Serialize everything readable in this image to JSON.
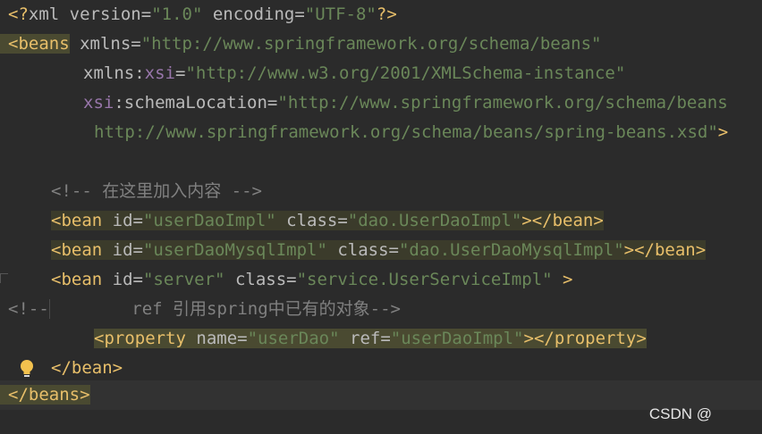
{
  "lines": {
    "l1": {
      "p1": "<?",
      "p2": "xml ",
      "p3": "version",
      "p4": "=",
      "p5": "\"1.0\"",
      "p6": " encoding",
      "p7": "=",
      "p8": "\"UTF-8\"",
      "p9": "?>"
    },
    "l2": {
      "p1": "<beans",
      "p2": " xmlns",
      "p3": "=",
      "p4": "\"http://www.springframework.org/schema/beans\""
    },
    "l3": {
      "p1": "xmlns",
      "p2": ":",
      "p3": "xsi",
      "p4": "=",
      "p5": "\"http://www.w3.org/2001/XMLSchema-instance\""
    },
    "l4": {
      "p1": "xsi",
      "p2": ":schemaLocation",
      "p3": "=",
      "p4": "\"http://www.springframework.org/schema/beans"
    },
    "l5": {
      "p1": "http://www.springframework.org/schema/beans/spring-beans.xsd\"",
      "p2": ">"
    },
    "l7": {
      "p1": "<!-- 在这里加入内容 -->"
    },
    "l8": {
      "p1": "<bean",
      "p2": " id",
      "p3": "=",
      "p4": "\"userDaoImpl\"",
      "p5": " class",
      "p6": "=",
      "p7": "\"dao.UserDaoImpl\"",
      "p8": "></bean>"
    },
    "l9": {
      "p1": "<bean",
      "p2": " id",
      "p3": "=",
      "p4": "\"userDaoMysqlImpl\"",
      "p5": " class",
      "p6": "=",
      "p7": "\"dao.UserDaoMysqlImpl\"",
      "p8": "></bean>"
    },
    "l10": {
      "p1": "<bean",
      "p2": " id",
      "p3": "=",
      "p4": "\"server\"",
      "p5": " class",
      "p6": "=",
      "p7": "\"service.UserServiceImpl\"",
      "p8": " >"
    },
    "l11": {
      "p1": "<!--",
      "p2": "        ref 引用spring中已有的对象-->"
    },
    "l12": {
      "p1": "<property",
      "p2": " name",
      "p3": "=",
      "p4": "\"userDao\"",
      "p5": " ref",
      "p6": "=",
      "p7": "\"userDaoImpl\"",
      "p8": "></property>"
    },
    "l13": {
      "p1": "</bean>"
    },
    "l14": {
      "p1": "</beans>"
    }
  },
  "watermark": "CSDN @",
  "icons": {
    "intention": "lightbulb-icon"
  },
  "colors": {
    "background": "#2b2b2b",
    "tag": "#e8bf6a",
    "value": "#6a8759",
    "namespace": "#9876aa",
    "comment": "#808080"
  }
}
